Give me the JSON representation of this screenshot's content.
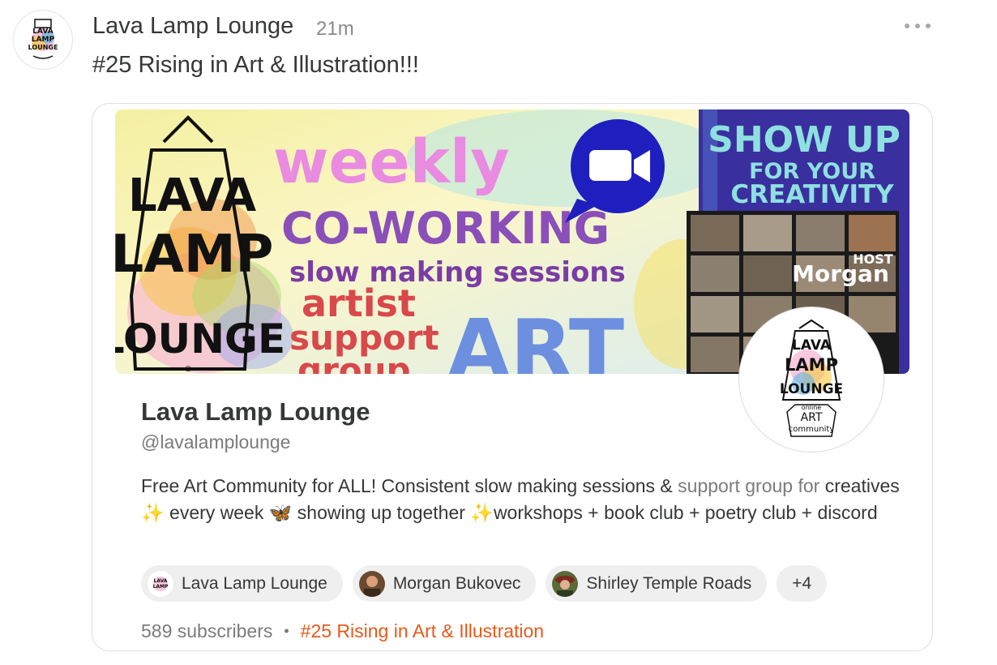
{
  "post": {
    "author": "Lava Lamp Lounge",
    "time": "21m",
    "text": "#25 Rising in Art & Illustration!!!",
    "avatar_icon": "lava-lamp-logo"
  },
  "banner": {
    "logo_text": [
      "LAVA",
      "LAMP",
      "LOUNGE"
    ],
    "weekly": "weekly",
    "coworking": "CO-WORKING",
    "slow_making": "slow making sessions",
    "artist": "artist",
    "support": "support",
    "group": "group",
    "art": "ART",
    "show_up": "SHOW UP",
    "for_your": "FOR YOUR",
    "creativity": "CREATIVITY",
    "host": "HOST",
    "morgan": "Morgan",
    "video_icon": "video-camera-icon"
  },
  "publication": {
    "name": "Lava Lamp Lounge",
    "handle": "@lavalamplounge",
    "desc_main": "Free Art Community for ALL! Consistent slow making sessions & ",
    "desc_accent": "support group for",
    "desc_line2": " creatives ✨ every week 🦋 showing up together ✨workshops + book club + poetry club + discord",
    "avatar_lines": [
      "LAVA",
      "LAMP",
      "LOUNGE"
    ],
    "avatar_sub": [
      "online",
      "ART",
      "community"
    ]
  },
  "chips": [
    {
      "label": "Lava Lamp Lounge",
      "avatar": "lava-lamp-logo"
    },
    {
      "label": "Morgan Bukovec",
      "avatar": "person-photo"
    },
    {
      "label": "Shirley Temple Roads",
      "avatar": "person-photo"
    }
  ],
  "chips_more": "+4",
  "footer": {
    "subscribers": "589 subscribers",
    "separator": "•",
    "rank": "#25 Rising in Art & Illustration"
  },
  "colors": {
    "accent_orange": "#e8591a",
    "text_dark": "#363737",
    "text_muted": "#7b7b7b",
    "banner_purple": "#3a2f9e",
    "zoom_blue": "#1f1fbf"
  }
}
